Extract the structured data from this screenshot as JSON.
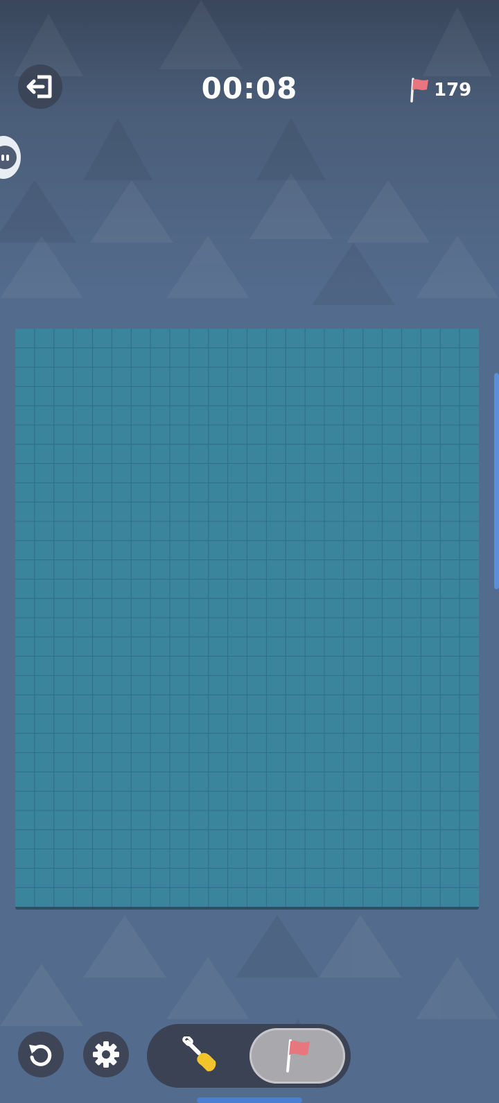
{
  "header": {
    "timer": "00:08",
    "flags_remaining": "179",
    "exit_icon": "exit-icon",
    "flag_icon": "flag-icon"
  },
  "chat": {
    "icon": "chat-bubble-icon"
  },
  "board": {
    "columns": 24,
    "rows": 30,
    "state": "all cells unrevealed",
    "color": "#3a849c",
    "line_color": "#2d6f87"
  },
  "toolbar": {
    "undo_icon": "undo-icon",
    "settings_icon": "gear-icon",
    "modes": [
      {
        "name": "dig",
        "icon": "shovel-icon",
        "selected": false
      },
      {
        "name": "flag",
        "icon": "flag-icon",
        "selected": true
      }
    ]
  },
  "colors": {
    "accent_flag": "#e8767f",
    "shovel": "#f3c52b",
    "toggle_selected": "#a9a9ad",
    "scrollbar": "#5a8ed6"
  }
}
